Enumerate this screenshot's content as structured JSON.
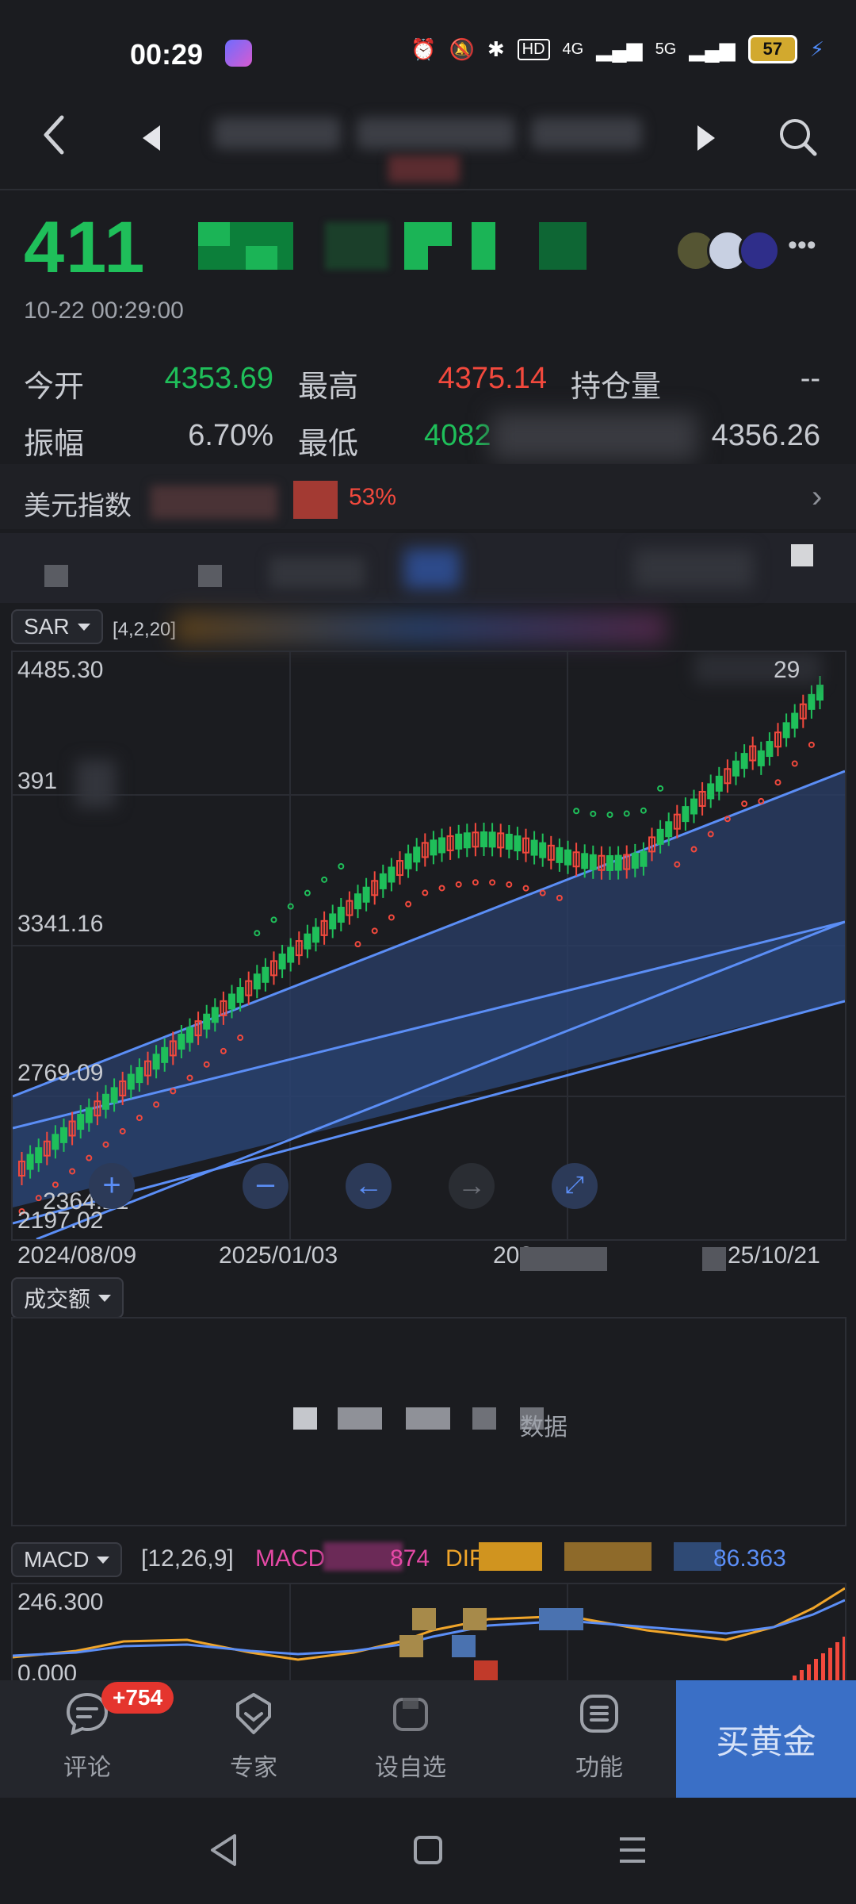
{
  "status_bar": {
    "time": "00:29",
    "network_hd": "HD",
    "network_4g": "4G",
    "network_5g": "5G",
    "battery": "57"
  },
  "header": {
    "back_icon": "chevron-left-icon",
    "prev_icon": "triangle-left-icon",
    "next_icon": "triangle-right-icon",
    "search_icon": "search-icon"
  },
  "quote": {
    "price": "411",
    "timestamp": "10-22 00:29:00",
    "stats": [
      {
        "label": "今开",
        "value": "4353.69",
        "color": "#1fbf5a"
      },
      {
        "label": "最高",
        "value": "4375.14",
        "color": "#f2493d"
      },
      {
        "label": "持仓量",
        "value": "--",
        "color": "#c7cad0"
      },
      {
        "label": "振幅",
        "value": "6.70%",
        "color": "#c7cad0"
      },
      {
        "label": "最低",
        "value": "4082",
        "color": "#1fbf5a"
      },
      {
        "label": "",
        "value": "4356.26",
        "color": "#c7cad0"
      }
    ]
  },
  "dxy": {
    "label": "美元指数",
    "change": "53%"
  },
  "main_indicator": {
    "name": "SAR",
    "params": "[4,2,20]"
  },
  "chart_data": {
    "type": "candlestick",
    "y_axis_labels": [
      "4485.30",
      "391",
      "3341.16",
      "2769.09",
      "2197.02"
    ],
    "last_value_label": "29",
    "overlay_label": "2364.21",
    "x_axis_labels": [
      "2024/08/09",
      "2025/01/03",
      "202",
      "25/10/21"
    ],
    "ylim": [
      2197.02,
      4485.3
    ]
  },
  "volume": {
    "selector": "成交额",
    "empty_text": "数据"
  },
  "macd": {
    "selector": "MACD",
    "params": "[12,26,9]",
    "macd_label": "MACD",
    "macd_value": "874",
    "dif_label": "DIF",
    "dea_value": "86.363",
    "y_labels": [
      "246.300",
      "0.000"
    ]
  },
  "toolbar": {
    "comment_badge": "+754",
    "comment": "评论",
    "expert": "专家",
    "watchlist": "设自选",
    "functions": "功能",
    "buy": "买黄金"
  }
}
